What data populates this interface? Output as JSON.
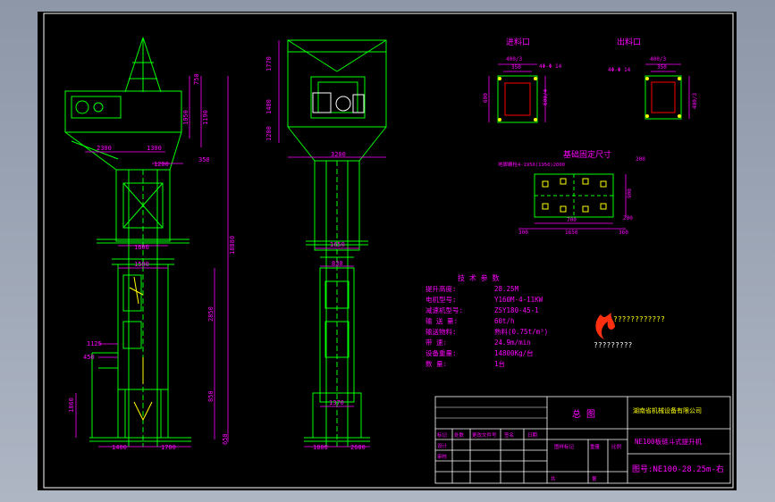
{
  "drawing": {
    "view_labels": {
      "inlet": "进料口",
      "outlet": "出料口",
      "foundation": "基础固定尺寸"
    },
    "inlet_dims": {
      "d1": "400/3",
      "d2": "350",
      "d3": "4Φ-Φ 14",
      "d4": "600",
      "d5": "600/4"
    },
    "outlet_dims": {
      "d1": "400/3",
      "d2": "350",
      "d3": "4Φ-Φ 14",
      "d4": "400/3"
    },
    "foundation_dims": {
      "bolt": "地脚螺栓4-1950(1950)2000",
      "a": "300",
      "b": "700",
      "c": "1650",
      "d": "360",
      "e": "900",
      "f": "200",
      "g": "200"
    },
    "left_view_dims": {
      "d1": "750",
      "d2": "1050",
      "d3": "1190",
      "d4": "1300",
      "d5": "2300",
      "d6": "350",
      "d7": "1200",
      "d8": "1600",
      "d9": "1500",
      "d10": "4600",
      "d11": "18880",
      "d12": "2850",
      "d13": "1125",
      "d14": "450",
      "d15": "850",
      "d16": "1860",
      "d17": "1400",
      "d18": "1700",
      "d19": "650",
      "d20": "1200"
    },
    "side_view_dims": {
      "d1": "1770",
      "d2": "1480",
      "d3": "1200",
      "d4": "3200",
      "d5": "1650",
      "d6": "830",
      "d7": "1370",
      "d8": "1800",
      "d9": "2600"
    },
    "tech_params": {
      "title": "技 术 参 数",
      "rows": [
        {
          "label": "提升高度:",
          "value": "28.25M"
        },
        {
          "label": "电机型号:",
          "value": "Y160M-4-11KW"
        },
        {
          "label": "减速机型号:",
          "value": "ZSY180-45-1"
        },
        {
          "label": "输 送 量:",
          "value": "60t/h"
        },
        {
          "label": "输送物料:",
          "value": "熟料(0.75t/m³)"
        },
        {
          "label": "带    速:",
          "value": "24.9m/min"
        },
        {
          "label": "设备重量:",
          "value": "14800Kg/台"
        },
        {
          "label": "数    量:",
          "value": "1台"
        }
      ]
    },
    "logo_text": {
      "top": "????????????",
      "bottom": "?????????"
    },
    "title_block": {
      "drawing_title": "总 图",
      "company": "湖南省机械设备有限公司",
      "product": "NE100板链斗式提升机",
      "drawing_no": "图号:NE100-28.25m-右",
      "header_cells": [
        "标记",
        "处数",
        "更改文件号",
        "签名",
        "日期"
      ],
      "row_designer": "设计",
      "row_check": "审核",
      "stage_label": "图样标记",
      "weight_label": "重量",
      "scale_label": "比例",
      "sheet_total": "共",
      "sheet_no": "第"
    }
  },
  "colors": {
    "sheet": "#000000",
    "green": "#00ff00",
    "magenta": "#ff00ff",
    "yellow": "#ffff00",
    "white": "#ffffff",
    "red": "#ff2020",
    "cyan": "#00ffff",
    "frame": "#ffffff"
  }
}
